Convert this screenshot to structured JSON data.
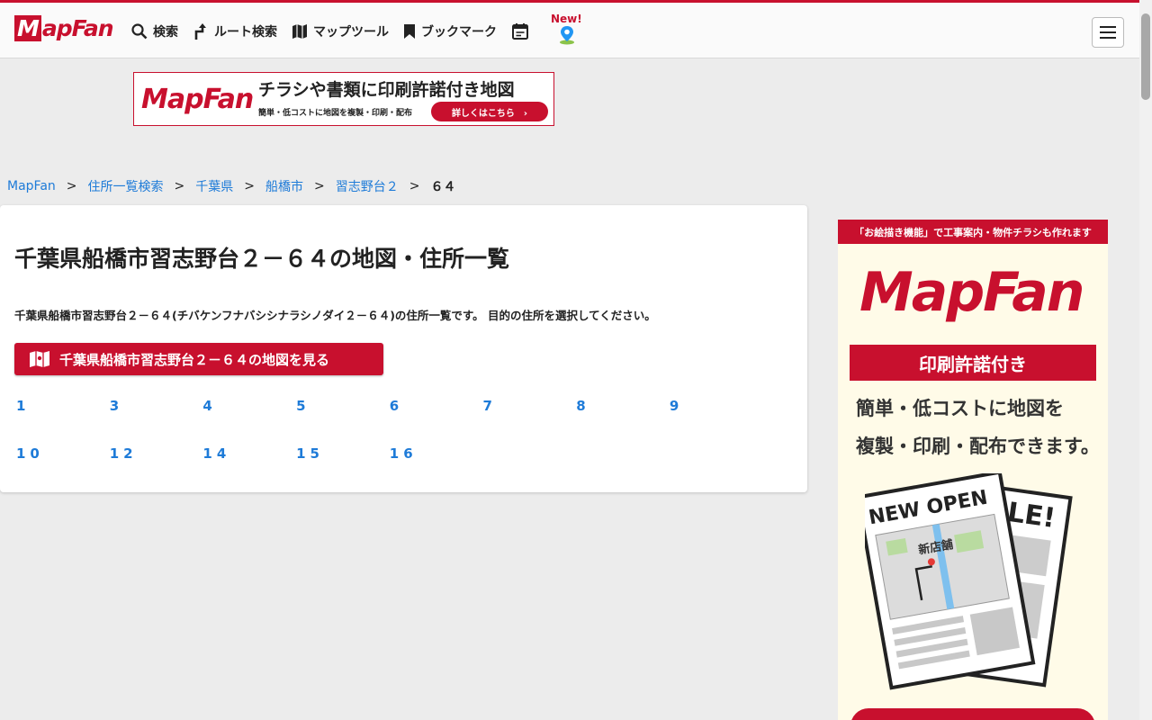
{
  "header": {
    "logo": "MapFan",
    "nav": [
      {
        "label": "検索",
        "icon": "search-icon"
      },
      {
        "label": "ルート検索",
        "icon": "route-icon"
      },
      {
        "label": "マップツール",
        "icon": "map-icon"
      },
      {
        "label": "ブックマーク",
        "icon": "bookmark-icon"
      }
    ],
    "new_label": "New!",
    "accent_color": "#c8102e"
  },
  "top_banner": {
    "logo": "MapFan",
    "headline": "チラシや書類に印刷許諾付き地図",
    "subtext": "簡単・低コストに地図を複製・印刷・配布",
    "button": "詳しくはこちら　›"
  },
  "breadcrumb": {
    "items": [
      "MapFan",
      "住所一覧検索",
      "千葉県",
      "船橋市",
      "習志野台２"
    ],
    "current": "６４",
    "separator": ">"
  },
  "main": {
    "title": "千葉県船橋市習志野台２－６４の地図・住所一覧",
    "description": "千葉県船橋市習志野台２－６４(チバケンフナバシシナラシノダイ２－６４)の住所一覧です。 目的の住所を選択してください。",
    "map_button": "千葉県船橋市習志野台２－６４の地図を見る",
    "numbers": [
      "1",
      "3",
      "4",
      "5",
      "6",
      "7",
      "8",
      "9",
      "10",
      "12",
      "14",
      "15",
      "16"
    ],
    "link_color": "#1e7bd8"
  },
  "side_ad": {
    "top_text": "「お絵描き機能」で工事案内・物件チラシも作れます",
    "logo": "MapFan",
    "band": "印刷許諾付き",
    "line1": "簡単・低コストに地図を",
    "line2": "複製・印刷・配布できます。",
    "flyer_title": "NEW OPEN",
    "flyer_store": "新店舗",
    "flyer_back": "LE!"
  }
}
